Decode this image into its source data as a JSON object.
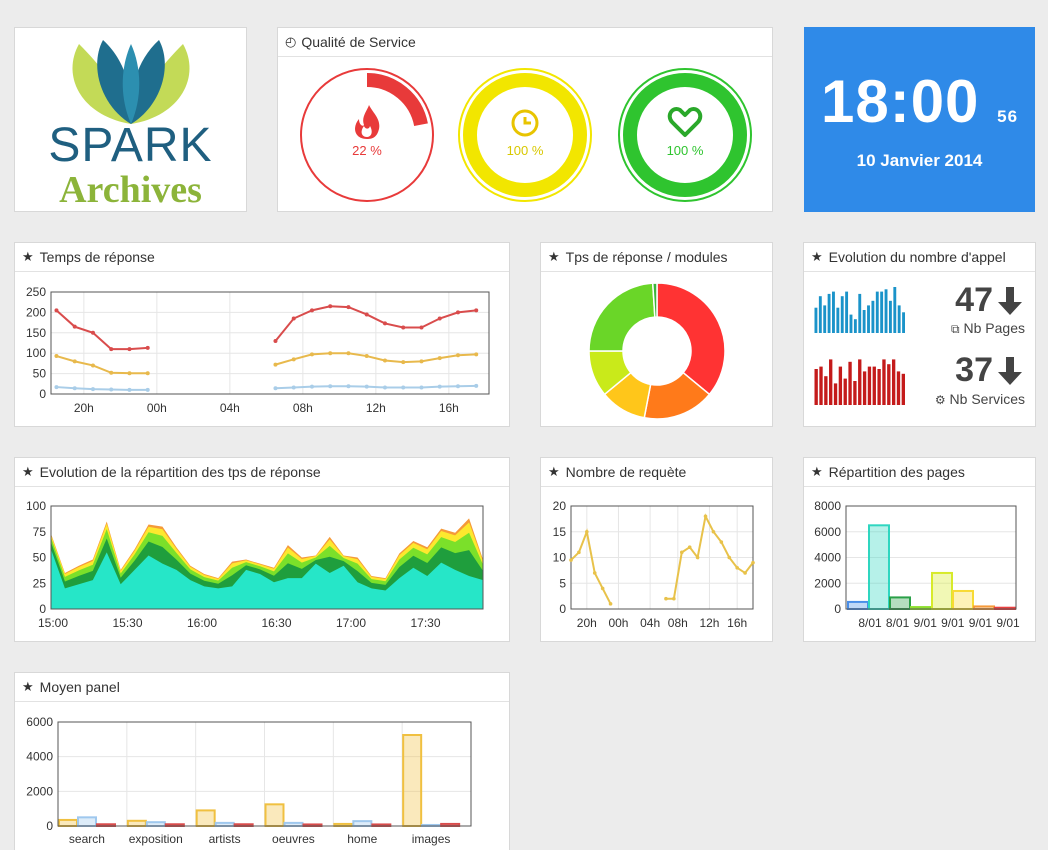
{
  "logo": {
    "line1": "SPARK",
    "line2": "Archives"
  },
  "qos": {
    "title": "Qualité de Service",
    "gauges": [
      {
        "icon": "fire-icon",
        "label": "22 %",
        "value": 22,
        "color": "#e83a3a"
      },
      {
        "icon": "clock-icon",
        "label": "100 %",
        "value": 100,
        "color": "#f2e600"
      },
      {
        "icon": "heart-icon",
        "label": "100 %",
        "value": 100,
        "color": "#2fc42f"
      }
    ]
  },
  "clock": {
    "time": "18:00",
    "seconds": "56",
    "date": "10 Janvier 2014"
  },
  "calls": {
    "title": "Evolution du nombre d'appel",
    "pages": {
      "value": "47",
      "label": "Nb Pages",
      "color": "#1a93c9",
      "bars": [
        0.55,
        0.8,
        0.6,
        0.85,
        0.9,
        0.55,
        0.8,
        0.9,
        0.4,
        0.3,
        0.85,
        0.5,
        0.6,
        0.7,
        0.9,
        0.9,
        0.95,
        0.7,
        1.0,
        0.6,
        0.45
      ]
    },
    "services": {
      "value": "37",
      "label": "Nb Services",
      "color": "#c41a1a",
      "bars": [
        0.75,
        0.8,
        0.6,
        0.95,
        0.45,
        0.8,
        0.55,
        0.9,
        0.5,
        0.95,
        0.7,
        0.8,
        0.8,
        0.75,
        0.95,
        0.85,
        0.95,
        0.7,
        0.65
      ]
    }
  },
  "charts": {
    "temps": {
      "title": "Temps de réponse",
      "chart_data": {
        "type": "line",
        "x_ticks": [
          "20h",
          "00h",
          "04h",
          "08h",
          "12h",
          "16h"
        ],
        "ylim": [
          0,
          250
        ],
        "y_ticks": [
          "0",
          "50",
          "100",
          "150",
          "200",
          "250"
        ],
        "series": [
          {
            "color": "#d94c4c",
            "segments": [
              [
                [
                  0,
                  205
                ],
                [
                  1,
                  165
                ],
                [
                  2,
                  150
                ],
                [
                  3,
                  110
                ],
                [
                  4,
                  110
                ],
                [
                  5,
                  113
                ]
              ],
              [
                [
                  12,
                  130
                ],
                [
                  13,
                  185
                ],
                [
                  14,
                  205
                ],
                [
                  15,
                  215
                ],
                [
                  16,
                  213
                ],
                [
                  17,
                  195
                ],
                [
                  18,
                  173
                ],
                [
                  19,
                  163
                ],
                [
                  20,
                  163
                ],
                [
                  21,
                  185
                ],
                [
                  22,
                  200
                ],
                [
                  23,
                  205
                ]
              ]
            ]
          },
          {
            "color": "#e8b94c",
            "segments": [
              [
                [
                  0,
                  93
                ],
                [
                  1,
                  80
                ],
                [
                  2,
                  70
                ],
                [
                  3,
                  52
                ],
                [
                  4,
                  51
                ],
                [
                  5,
                  51
                ]
              ],
              [
                [
                  12,
                  72
                ],
                [
                  13,
                  85
                ],
                [
                  14,
                  97
                ],
                [
                  15,
                  100
                ],
                [
                  16,
                  100
                ],
                [
                  17,
                  93
                ],
                [
                  18,
                  82
                ],
                [
                  19,
                  78
                ],
                [
                  20,
                  80
                ],
                [
                  21,
                  88
                ],
                [
                  22,
                  95
                ],
                [
                  23,
                  97
                ]
              ]
            ]
          },
          {
            "color": "#a9cde8",
            "segments": [
              [
                [
                  0,
                  17
                ],
                [
                  1,
                  14
                ],
                [
                  2,
                  12
                ],
                [
                  3,
                  11
                ],
                [
                  4,
                  10
                ],
                [
                  5,
                  10
                ]
              ],
              [
                [
                  12,
                  14
                ],
                [
                  13,
                  16
                ],
                [
                  14,
                  18
                ],
                [
                  15,
                  19
                ],
                [
                  16,
                  19
                ],
                [
                  17,
                  18
                ],
                [
                  18,
                  16
                ],
                [
                  19,
                  16
                ],
                [
                  20,
                  16
                ],
                [
                  21,
                  18
                ],
                [
                  22,
                  19
                ],
                [
                  23,
                  20
                ]
              ]
            ]
          }
        ]
      }
    },
    "modules": {
      "title": "Tps de réponse / modules",
      "chart_data": {
        "type": "pie",
        "values": [
          36,
          17,
          11,
          11,
          24,
          1
        ],
        "colors": [
          "#ff3333",
          "#ff7a1a",
          "#ffc61a",
          "#c9ea1a",
          "#6ad628",
          "#3cb43c"
        ]
      }
    },
    "repartition": {
      "title": "Evolution de la répartition des tps de réponse",
      "chart_data": {
        "type": "area",
        "x_ticks": [
          "15:00",
          "15:30",
          "16:00",
          "16:30",
          "17:00",
          "17:30"
        ],
        "ylim": [
          0,
          100
        ],
        "y_ticks": [
          "0",
          "25",
          "50",
          "75",
          "100"
        ],
        "colors": [
          "#26e6c8",
          "#1f9e3d",
          "#7be02a",
          "#fde82e",
          "#f59a3a"
        ],
        "teal": [
          58,
          20,
          24,
          28,
          55,
          24,
          38,
          52,
          44,
          38,
          28,
          22,
          20,
          22,
          38,
          34,
          26,
          30,
          30,
          44,
          35,
          42,
          26,
          20,
          18,
          30,
          40,
          32,
          45,
          38,
          32,
          28
        ],
        "totals": [
          73,
          35,
          42,
          48,
          85,
          38,
          58,
          82,
          80,
          60,
          42,
          34,
          30,
          46,
          48,
          44,
          40,
          62,
          50,
          52,
          70,
          52,
          50,
          32,
          30,
          54,
          66,
          60,
          78,
          74,
          88,
          48
        ]
      }
    },
    "requetes": {
      "title": "Nombre de requète",
      "chart_data": {
        "type": "line",
        "color": "#e8c24a",
        "x_ticks": [
          "20h",
          "00h",
          "04h",
          "08h",
          "12h",
          "16h"
        ],
        "ylim": [
          0,
          20
        ],
        "y_ticks": [
          "0",
          "5",
          "10",
          "15",
          "20"
        ],
        "segments": [
          [
            [
              0,
              9.5
            ],
            [
              1,
              11
            ],
            [
              2,
              15
            ],
            [
              3,
              7
            ],
            [
              4,
              4
            ],
            [
              5,
              1
            ]
          ],
          [
            [
              12,
              2
            ],
            [
              13,
              2
            ],
            [
              14,
              11
            ],
            [
              15,
              12
            ],
            [
              16,
              10
            ],
            [
              17,
              18
            ],
            [
              18,
              15
            ],
            [
              19,
              13
            ],
            [
              20,
              10
            ],
            [
              21,
              8
            ],
            [
              22,
              7
            ],
            [
              23,
              9
            ]
          ]
        ]
      }
    },
    "pages": {
      "title": "Répartition des pages",
      "chart_data": {
        "type": "bar",
        "x_ticks": [
          "8/01",
          "8/01",
          "9/01",
          "9/01",
          "9/01",
          "9/01"
        ],
        "ylim": [
          0,
          8000
        ],
        "y_ticks": [
          "0",
          "2000",
          "4000",
          "6000",
          "8000"
        ],
        "values": [
          550,
          6500,
          900,
          150,
          2800,
          1400,
          200,
          100
        ],
        "colors": [
          "#4a8ee8",
          "#2fd6c0",
          "#2aa048",
          "#8ee030",
          "#d7ea2a",
          "#f8da34",
          "#f59a3a",
          "#ea4040"
        ]
      }
    },
    "moyen": {
      "title": "Moyen panel",
      "chart_data": {
        "type": "bar",
        "categories": [
          "search",
          "exposition",
          "artists",
          "oeuvres",
          "home",
          "images"
        ],
        "ylim": [
          0,
          6000
        ],
        "y_ticks": [
          "0",
          "2000",
          "4000",
          "6000"
        ],
        "colors": [
          "#f0c040",
          "#9fc8ee",
          "#d94c4c"
        ],
        "series": [
          {
            "values": [
              350,
              300,
              900,
              1250,
              120,
              5250
            ]
          },
          {
            "values": [
              500,
              220,
              180,
              180,
              280,
              60
            ]
          },
          {
            "values": [
              100,
              100,
              100,
              90,
              90,
              120
            ]
          }
        ]
      }
    }
  }
}
